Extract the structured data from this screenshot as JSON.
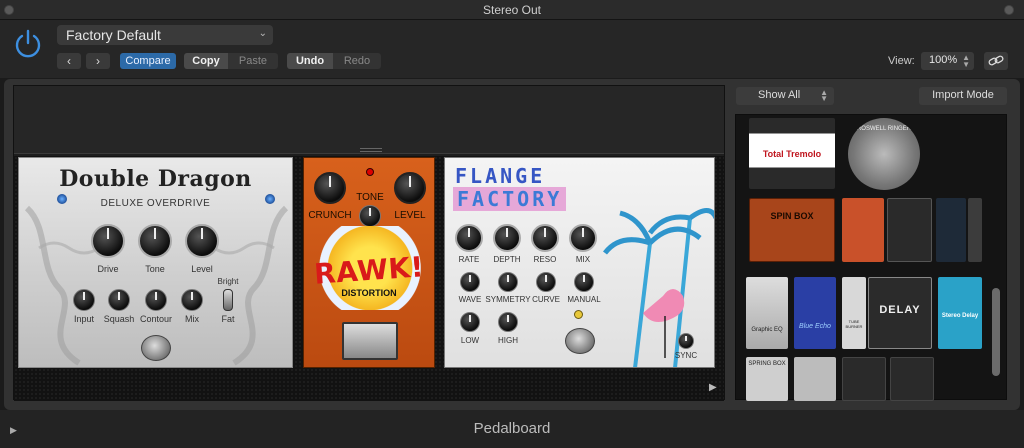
{
  "window": {
    "title": "Stereo Out"
  },
  "header": {
    "preset": "Factory Default",
    "compare": "Compare",
    "copy": "Copy",
    "paste": "Paste",
    "undo": "Undo",
    "redo": "Redo",
    "view_label": "View:",
    "view_value": "100%"
  },
  "browser": {
    "filter": "Show All",
    "import": "Import Mode"
  },
  "pedals": {
    "double_dragon": {
      "title": "Double Dragon",
      "subtitle": "DELUXE OVERDRIVE",
      "big_knobs": [
        "Drive",
        "Tone",
        "Level"
      ],
      "small_knobs": [
        "Input",
        "Squash",
        "Contour",
        "Mix"
      ],
      "switch_top": "Bright",
      "switch_bottom": "Fat"
    },
    "rawk": {
      "knob_left": "CRUNCH",
      "knob_mid": "TONE",
      "knob_right": "LEVEL",
      "word": "RAWK!",
      "sub": "DISTORTION"
    },
    "flange": {
      "title_1": "FLANGE",
      "title_2": "FACTORY",
      "row1": [
        "RATE",
        "DEPTH",
        "RESO",
        "MIX"
      ],
      "row2": [
        "WAVE",
        "SYMMETRY",
        "CURVE",
        "MANUAL"
      ],
      "row3": [
        "LOW",
        "HIGH"
      ],
      "sync": "SYNC"
    }
  },
  "thumbs": {
    "total_tremolo": "Total Tremolo",
    "spin_box": "SPIN BOX",
    "graphic_eq": "Graphic EQ",
    "blue_echo": "Blue Echo",
    "delay": "DELAY",
    "roswell": "ROSWELL RINGER",
    "tube_burner": "TUBE BURNER",
    "spring_box": "SPRING BOX",
    "stereo_delay": "Stereo Delay"
  },
  "footer": {
    "name": "Pedalboard"
  }
}
